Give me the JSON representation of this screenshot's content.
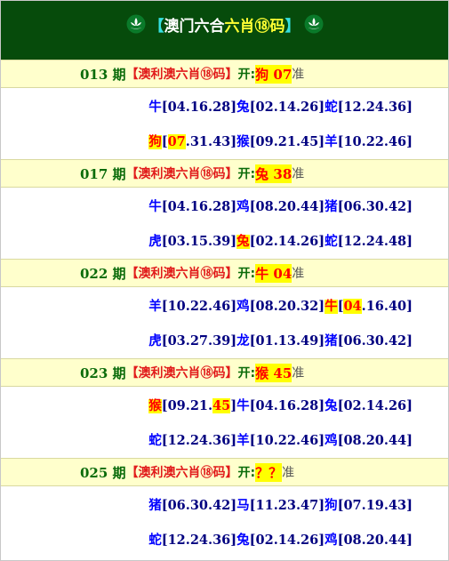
{
  "header": {
    "title_left_bracket": "【",
    "title_white": "澳门六合",
    "title_yellow": "六肖⑱码",
    "title_right_bracket": "】"
  },
  "records": [
    {
      "period": "013 期",
      "source": "【澳利澳六肖⑱码】",
      "open_label": "开:",
      "result": "狗 07",
      "zhun": "准",
      "rows": [
        [
          {
            "animal": "牛",
            "nums": [
              "04",
              "16",
              "28"
            ],
            "hit": false,
            "hit_num": ""
          },
          {
            "animal": "兔",
            "nums": [
              "02",
              "14",
              "26"
            ],
            "hit": false,
            "hit_num": ""
          },
          {
            "animal": "蛇",
            "nums": [
              "12",
              "24",
              "36"
            ],
            "hit": false,
            "hit_num": ""
          }
        ],
        [
          {
            "animal": "狗",
            "nums": [
              "07",
              "31",
              "43"
            ],
            "hit": true,
            "hit_num": "07"
          },
          {
            "animal": "猴",
            "nums": [
              "09",
              "21",
              "45"
            ],
            "hit": false,
            "hit_num": ""
          },
          {
            "animal": "羊",
            "nums": [
              "10",
              "22",
              "46"
            ],
            "hit": false,
            "hit_num": ""
          }
        ]
      ]
    },
    {
      "period": "017 期",
      "source": "【澳利澳六肖⑱码】",
      "open_label": "开:",
      "result": "兔 38",
      "zhun": "准",
      "rows": [
        [
          {
            "animal": "牛",
            "nums": [
              "04",
              "16",
              "28"
            ],
            "hit": false,
            "hit_num": ""
          },
          {
            "animal": "鸡",
            "nums": [
              "08",
              "20",
              "44"
            ],
            "hit": false,
            "hit_num": ""
          },
          {
            "animal": "猪",
            "nums": [
              "06",
              "30",
              "42"
            ],
            "hit": false,
            "hit_num": ""
          }
        ],
        [
          {
            "animal": "虎",
            "nums": [
              "03",
              "15",
              "39"
            ],
            "hit": false,
            "hit_num": ""
          },
          {
            "animal": "兔",
            "nums": [
              "02",
              "14",
              "26"
            ],
            "hit": true,
            "hit_num": ""
          },
          {
            "animal": "蛇",
            "nums": [
              "12",
              "24",
              "48"
            ],
            "hit": false,
            "hit_num": ""
          }
        ]
      ]
    },
    {
      "period": "022 期",
      "source": "【澳利澳六肖⑱码】",
      "open_label": "开:",
      "result": "牛 04",
      "zhun": "准",
      "rows": [
        [
          {
            "animal": "羊",
            "nums": [
              "10",
              "22",
              "46"
            ],
            "hit": false,
            "hit_num": ""
          },
          {
            "animal": "鸡",
            "nums": [
              "08",
              "20",
              "32"
            ],
            "hit": false,
            "hit_num": ""
          },
          {
            "animal": "牛",
            "nums": [
              "04",
              "16",
              "40"
            ],
            "hit": true,
            "hit_num": "04"
          }
        ],
        [
          {
            "animal": "虎",
            "nums": [
              "03",
              "27",
              "39"
            ],
            "hit": false,
            "hit_num": ""
          },
          {
            "animal": "龙",
            "nums": [
              "01",
              "13",
              "49"
            ],
            "hit": false,
            "hit_num": ""
          },
          {
            "animal": "猪",
            "nums": [
              "06",
              "30",
              "42"
            ],
            "hit": false,
            "hit_num": ""
          }
        ]
      ]
    },
    {
      "period": "023 期",
      "source": "【澳利澳六肖⑱码】",
      "open_label": "开:",
      "result": "猴 45",
      "zhun": "准",
      "rows": [
        [
          {
            "animal": "猴",
            "nums": [
              "09",
              "21",
              "45"
            ],
            "hit": true,
            "hit_num": "45"
          },
          {
            "animal": "牛",
            "nums": [
              "04",
              "16",
              "28"
            ],
            "hit": false,
            "hit_num": ""
          },
          {
            "animal": "兔",
            "nums": [
              "02",
              "14",
              "26"
            ],
            "hit": false,
            "hit_num": ""
          }
        ],
        [
          {
            "animal": "蛇",
            "nums": [
              "12",
              "24",
              "36"
            ],
            "hit": false,
            "hit_num": ""
          },
          {
            "animal": "羊",
            "nums": [
              "10",
              "22",
              "46"
            ],
            "hit": false,
            "hit_num": ""
          },
          {
            "animal": "鸡",
            "nums": [
              "08",
              "20",
              "44"
            ],
            "hit": false,
            "hit_num": ""
          }
        ]
      ]
    },
    {
      "period": "025 期",
      "source": "【澳利澳六肖⑱码】",
      "open_label": "开:",
      "result": "？？",
      "zhun": "准",
      "rows": [
        [
          {
            "animal": "猪",
            "nums": [
              "06",
              "30",
              "42"
            ],
            "hit": false,
            "hit_num": ""
          },
          {
            "animal": "马",
            "nums": [
              "11",
              "23",
              "47"
            ],
            "hit": false,
            "hit_num": ""
          },
          {
            "animal": "狗",
            "nums": [
              "07",
              "19",
              "43"
            ],
            "hit": false,
            "hit_num": ""
          }
        ],
        [
          {
            "animal": "蛇",
            "nums": [
              "12",
              "24",
              "36"
            ],
            "hit": false,
            "hit_num": ""
          },
          {
            "animal": "兔",
            "nums": [
              "02",
              "14",
              "26"
            ],
            "hit": false,
            "hit_num": ""
          },
          {
            "animal": "鸡",
            "nums": [
              "08",
              "20",
              "44"
            ],
            "hit": false,
            "hit_num": ""
          }
        ]
      ]
    }
  ],
  "colors": {
    "header_bg": "#064b0b",
    "period_bg": "#ffffcc",
    "highlight_bg": "#ffff00",
    "highlight_text": "#ff0000",
    "animal_text": "#0000ff",
    "number_text": "#000080"
  },
  "icons": {
    "left": "lotus-icon",
    "right": "lotus-icon"
  }
}
